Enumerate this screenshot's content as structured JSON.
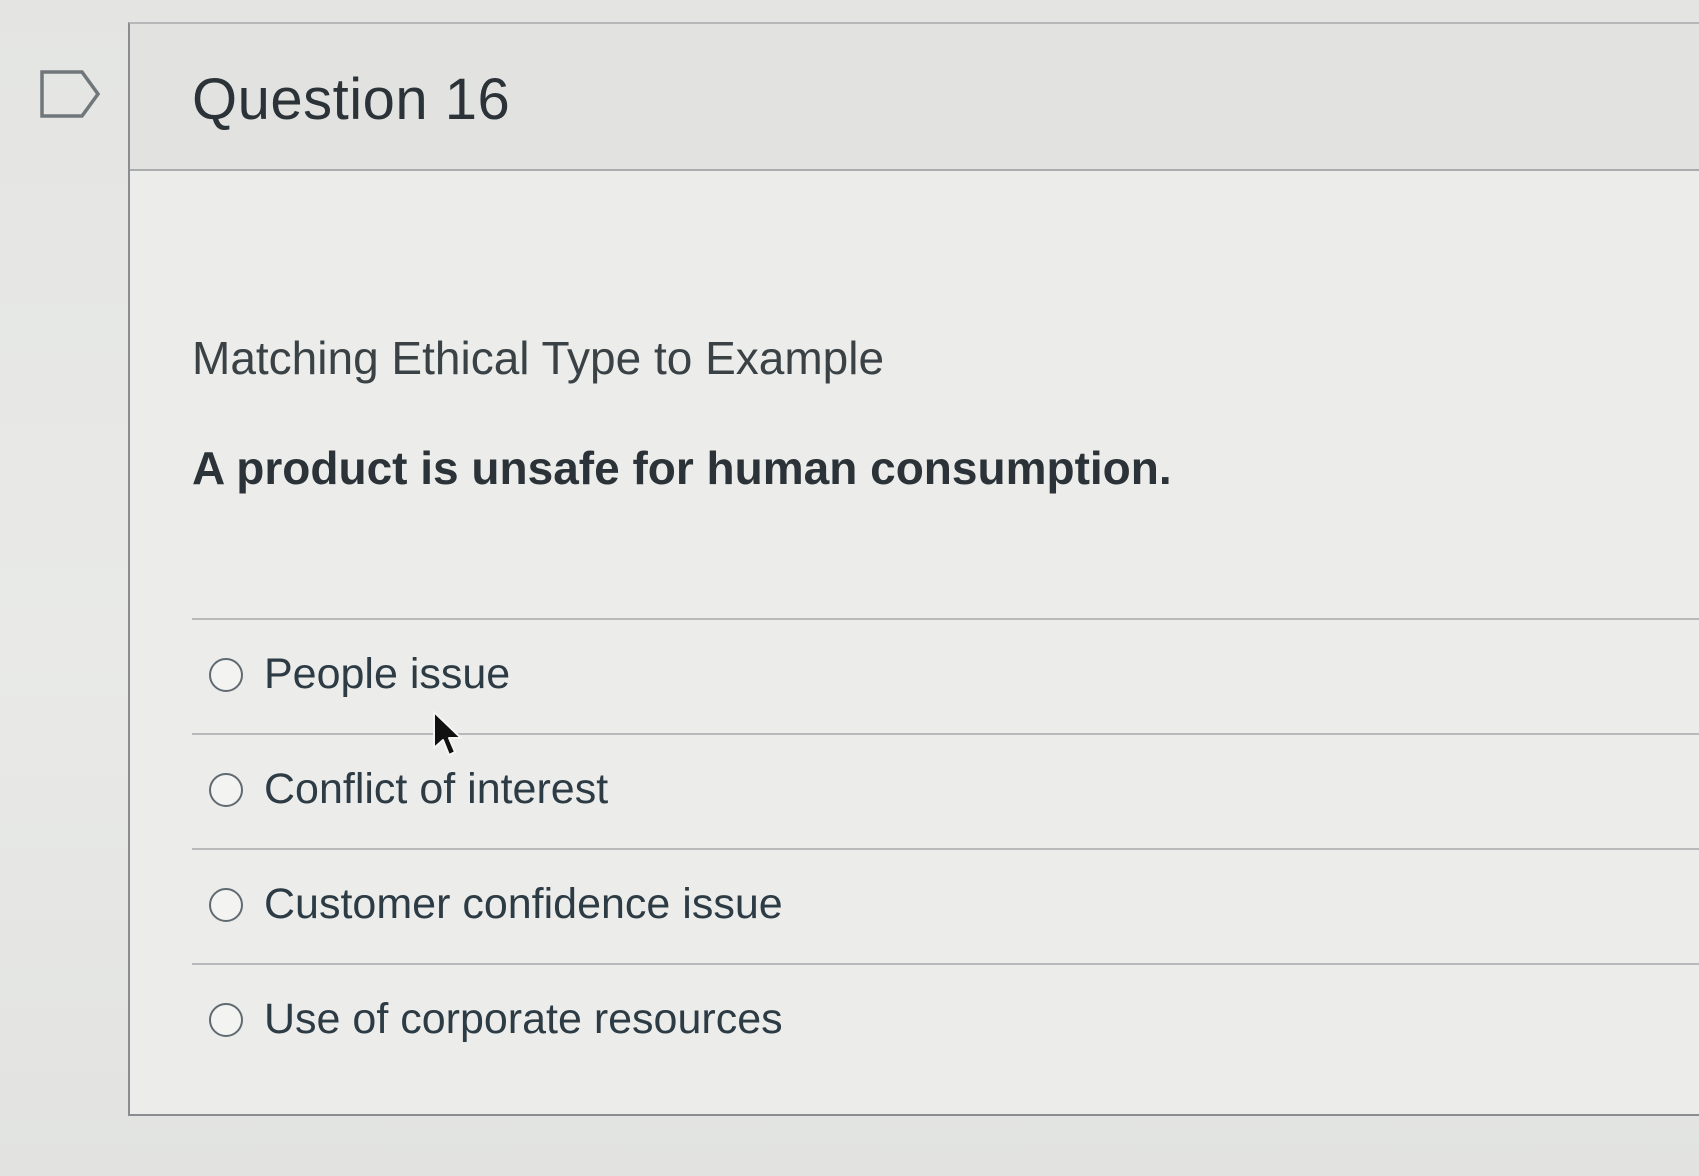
{
  "question": {
    "title": "Question 16",
    "prompt_title": "Matching Ethical Type to Example",
    "prompt_text": "A product is unsafe for human consumption.",
    "answers": [
      {
        "label": "People issue",
        "selected": false
      },
      {
        "label": "Conflict of interest",
        "selected": false
      },
      {
        "label": "Customer confidence issue",
        "selected": false
      },
      {
        "label": "Use of corporate resources",
        "selected": false
      }
    ]
  },
  "icons": {
    "flag": "flag-question-icon",
    "radio": "radio-unselected-icon",
    "cursor": "mouse-pointer-icon"
  },
  "colors": {
    "text": "#2d3b45",
    "border": "#8a8d8f",
    "background": "#e6e7e5"
  }
}
